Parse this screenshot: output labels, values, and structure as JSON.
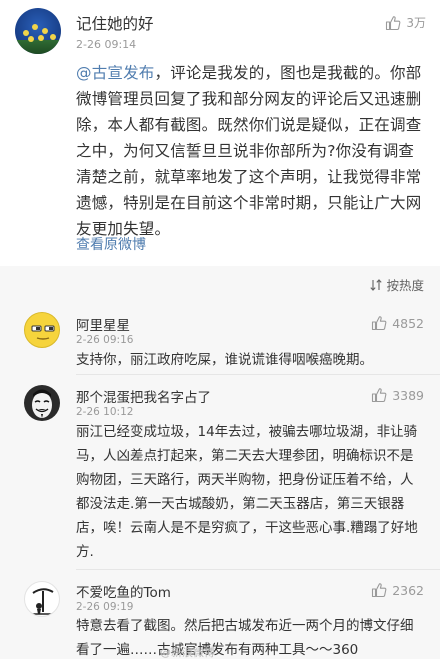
{
  "post": {
    "author": "记住她的好",
    "time": "2-26 09:14",
    "likes": "3万",
    "mention": "@古宣发布",
    "text": "，评论是我发的，图也是我截的。你部微博管理员回复了我和部分网友的评论后又迅速删除，本人都有截图。既然你们说是疑似，正在调查之中，为何又信誓旦旦说非你部所为?你没有调查清楚之前，就草率地发了这个声明，让我觉得非常遗憾，特别是在目前这个非常时期，只能让广大网友更加失望。",
    "view_original": "查看原微博"
  },
  "sort": {
    "label": "按热度"
  },
  "comments": [
    {
      "author": "阿里星星",
      "time": "2-26 09:16",
      "likes": "4852",
      "text": "支持你，丽江政府吃屎，谁说谎谁得咽喉癌晚期。"
    },
    {
      "author": "那个混蛋把我名字占了",
      "time": "2-26 10:12",
      "likes": "3389",
      "text": "丽江已经变成垃圾，14年去过，被骗去哪垃圾湖，非让骑马，人凶差点打起来，第二天去大理参团，明确标识不是购物团，三天路行，两天半购物，把身份证压着不给，人都没法走.第一天古城酸奶，第二天玉器店，第三天银器店，唉！云南人是不是穷疯了，干这些恶心事.糟蹋了好地方."
    },
    {
      "author": "不爱吃鱼的Tom",
      "time": "2-26 09:19",
      "likes": "2362",
      "text": "特意去看了截图。然后把古城发布近一两个月的博文仔细看了一遍……古城官博发布有两种工具～～360"
    }
  ],
  "watermark": "@新浪微博",
  "colors": {
    "link": "#507daf",
    "meta": "#9a9a9a",
    "background": "#f7f7f7"
  }
}
